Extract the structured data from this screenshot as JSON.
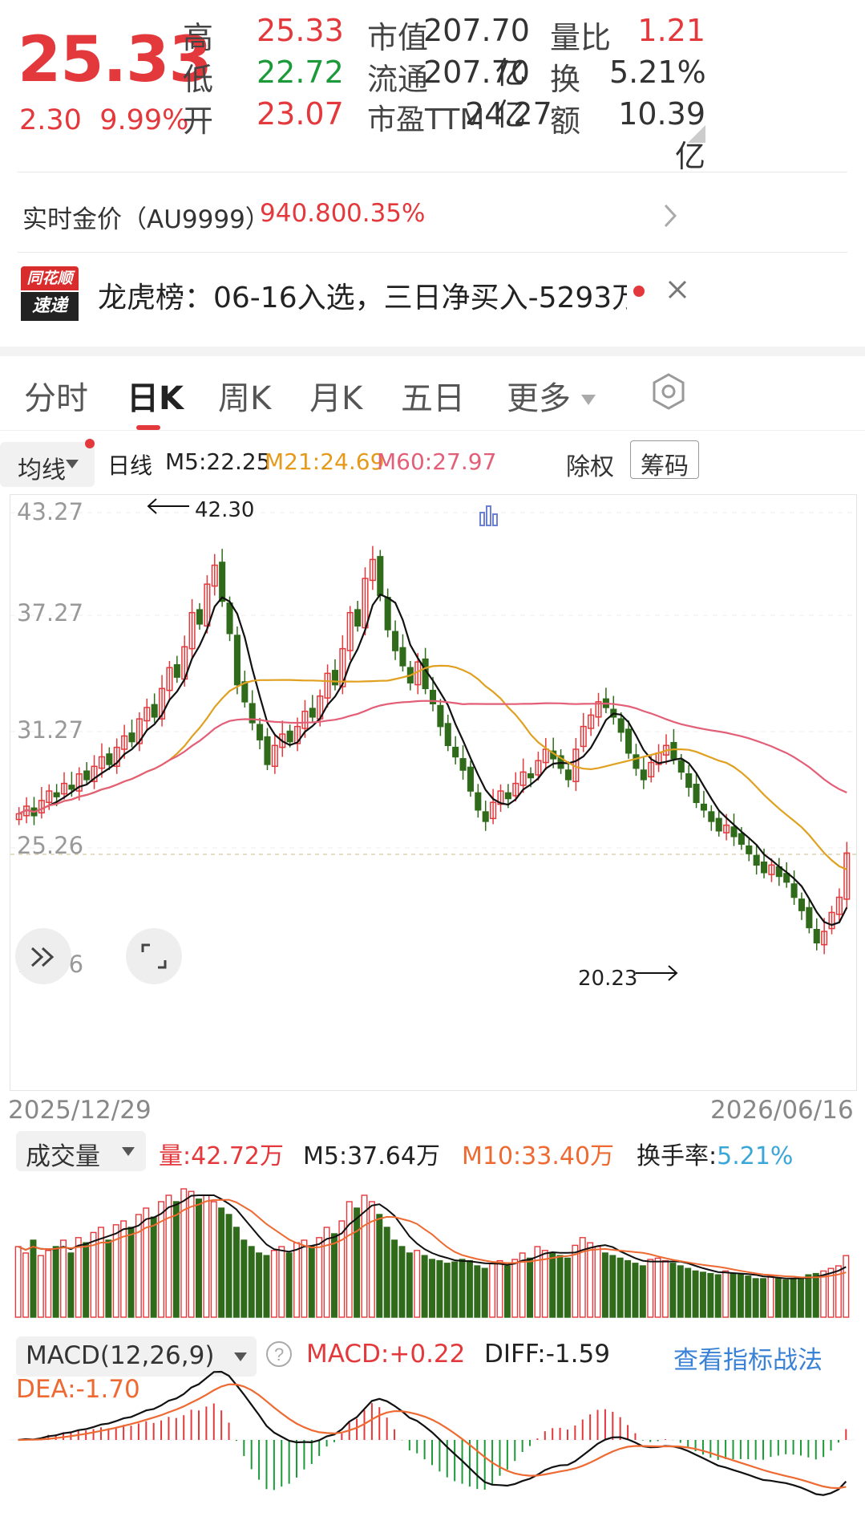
{
  "quote": {
    "price": "25.33",
    "change": "2.30",
    "change_pct": "9.99%",
    "high_label": "高",
    "high": "25.33",
    "low_label": "低",
    "low": "22.72",
    "open_label": "开",
    "open": "23.07",
    "mktcap_label": "市值",
    "mktcap": "207.70亿",
    "float_label": "流通",
    "float": "207.70亿",
    "pe_label": "市盈TTM",
    "pe": "24.27",
    "volratio_label": "量比",
    "volratio": "1.21",
    "turnover_label": "换",
    "turnover": "5.21%",
    "amount_label": "额",
    "amount": "10.39亿"
  },
  "gold": {
    "label": "实时金价（AU9999）",
    "price": "940.80",
    "pct": "0.35%"
  },
  "news": {
    "logo_top": "同花顺",
    "logo_bottom": "速递",
    "text": "龙虎榜：06-16入选，三日净买入-5293万…"
  },
  "tabs": [
    "分时",
    "日K",
    "周K",
    "月K",
    "五日",
    "更多"
  ],
  "active_tab": "日K",
  "ma": {
    "selector": "均线",
    "period": "日线",
    "m5": "M5:22.25",
    "m21": "M21:24.69",
    "m60": "M60:27.97",
    "adjust": "除权",
    "chips": "筹码"
  },
  "colors": {
    "up": "#e4393c",
    "down": "#2f6b1a",
    "ma5": "#111111",
    "ma21": "#e0a020",
    "ma60": "#e35f78",
    "accent": "#3a82d6"
  },
  "price_chart": {
    "y_labels": [
      "43.27",
      "37.27",
      "31.27",
      "25.26",
      "19.26"
    ],
    "max_annotation": "42.30",
    "min_annotation": "20.23",
    "start_date": "2025/12/29",
    "end_date": "2026/06/16"
  },
  "volume": {
    "selector": "成交量",
    "vol": "量:42.72万",
    "m5": "M5:37.64万",
    "m10": "M10:33.40万",
    "turnover_label": "换手率:",
    "turnover": "5.21%"
  },
  "macd": {
    "selector": "MACD(12,26,9)",
    "macd": "MACD:+0.22",
    "diff": "DIFF:-1.59",
    "dea": "DEA:-1.70",
    "link": "查看指标战法"
  },
  "chart_data": {
    "type": "candlestick",
    "ylim": [
      19.26,
      43.27
    ],
    "closes": [
      27.4,
      27.8,
      27.3,
      28.1,
      28.6,
      28.3,
      29.0,
      28.7,
      29.5,
      29.2,
      29.9,
      30.4,
      30.0,
      30.9,
      31.5,
      31.2,
      32.4,
      33.0,
      32.5,
      34.0,
      35.1,
      34.6,
      36.2,
      38.0,
      37.4,
      39.5,
      40.5,
      38.6,
      36.9,
      34.2,
      33.3,
      32.2,
      31.3,
      30.0,
      31.0,
      31.6,
      31.2,
      32.0,
      32.8,
      32.5,
      33.6,
      34.8,
      34.2,
      36.1,
      38.0,
      37.3,
      39.8,
      40.8,
      38.9,
      37.1,
      36.0,
      35.2,
      34.3,
      35.4,
      34.0,
      33.2,
      32.0,
      31.0,
      30.4,
      29.7,
      28.6,
      27.6,
      27.0,
      28.0,
      28.6,
      28.2,
      29.0,
      29.6,
      29.3,
      30.2,
      30.8,
      30.3,
      29.8,
      29.2,
      30.8,
      32.0,
      32.6,
      33.3,
      33.0,
      32.5,
      31.7,
      30.6,
      29.8,
      29.2,
      30.1,
      30.6,
      31.0,
      30.3,
      29.6,
      28.8,
      28.0,
      27.6,
      27.0,
      26.5,
      26.8,
      26.2,
      25.8,
      25.3,
      24.7,
      24.3,
      24.7,
      24.1,
      23.8,
      23.0,
      22.3,
      21.4,
      20.6,
      21.2,
      22.2,
      23.0,
      25.33
    ],
    "ma5_ref": "M5:22.25",
    "ma21_ref": "M21:24.69",
    "ma60_ref": "M60:27.97",
    "volume_rel": [
      0.55,
      0.5,
      0.6,
      0.48,
      0.52,
      0.55,
      0.6,
      0.5,
      0.62,
      0.58,
      0.66,
      0.7,
      0.6,
      0.72,
      0.75,
      0.7,
      0.8,
      0.85,
      0.78,
      0.9,
      0.95,
      0.9,
      1.0,
      0.98,
      0.92,
      0.95,
      0.9,
      0.85,
      0.8,
      0.7,
      0.6,
      0.55,
      0.5,
      0.48,
      0.52,
      0.55,
      0.5,
      0.58,
      0.6,
      0.55,
      0.62,
      0.7,
      0.65,
      0.75,
      0.9,
      0.85,
      0.95,
      0.9,
      0.8,
      0.7,
      0.6,
      0.55,
      0.5,
      0.52,
      0.48,
      0.45,
      0.44,
      0.42,
      0.43,
      0.45,
      0.44,
      0.4,
      0.38,
      0.42,
      0.44,
      0.4,
      0.45,
      0.5,
      0.46,
      0.55,
      0.52,
      0.5,
      0.48,
      0.46,
      0.56,
      0.62,
      0.58,
      0.55,
      0.5,
      0.48,
      0.46,
      0.44,
      0.42,
      0.4,
      0.45,
      0.46,
      0.44,
      0.42,
      0.4,
      0.38,
      0.36,
      0.35,
      0.34,
      0.33,
      0.36,
      0.34,
      0.33,
      0.32,
      0.3,
      0.3,
      0.32,
      0.3,
      0.29,
      0.3,
      0.31,
      0.33,
      0.34,
      0.36,
      0.38,
      0.4,
      0.48
    ]
  }
}
